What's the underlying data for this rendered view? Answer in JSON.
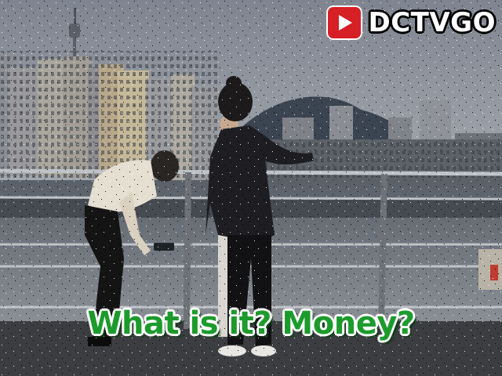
{
  "overlay": {
    "channel_name": "DCTVGO",
    "logo_icon": "youtube-play-icon",
    "caption": "What is it? Money?",
    "caption_color": "#1c9b2c",
    "logo_color": "#d71f26"
  },
  "scene": {
    "description_icon": "riverside-photo"
  }
}
